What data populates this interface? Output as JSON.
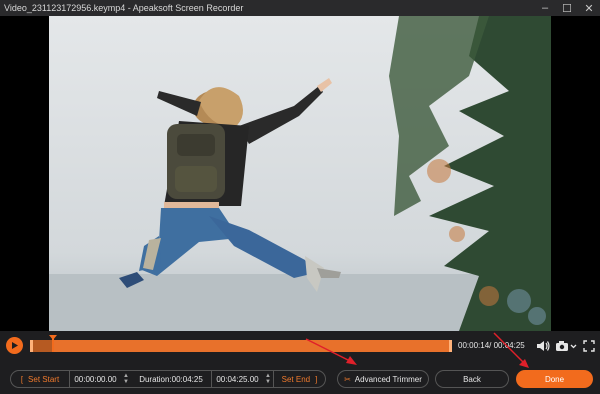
{
  "window": {
    "title": "Video_231123172956.keymp4  -  Apeaksoft Screen Recorder",
    "minimize": "–",
    "maximize": "☐",
    "close": "✕"
  },
  "timeline": {
    "timecode": "00:00:14/ 00:04:25",
    "progress": 0.053
  },
  "icons": {
    "play": "play-icon",
    "volume": "volume-icon",
    "camera": "camera-icon",
    "fullscreen": "fullscreen-icon",
    "trimmer": "scissors-icon"
  },
  "controls": {
    "set_start": "Set Start",
    "start_time": "00:00:00.00",
    "duration": "Duration:00:04:25",
    "end_time": "00:04:25.00",
    "set_end": "Set End",
    "advanced_trimmer": "Advanced Trimmer",
    "back": "Back",
    "done": "Done"
  },
  "colors": {
    "accent": "#f26b1d",
    "track": "#e8712b",
    "annotation": "#e0202a"
  }
}
